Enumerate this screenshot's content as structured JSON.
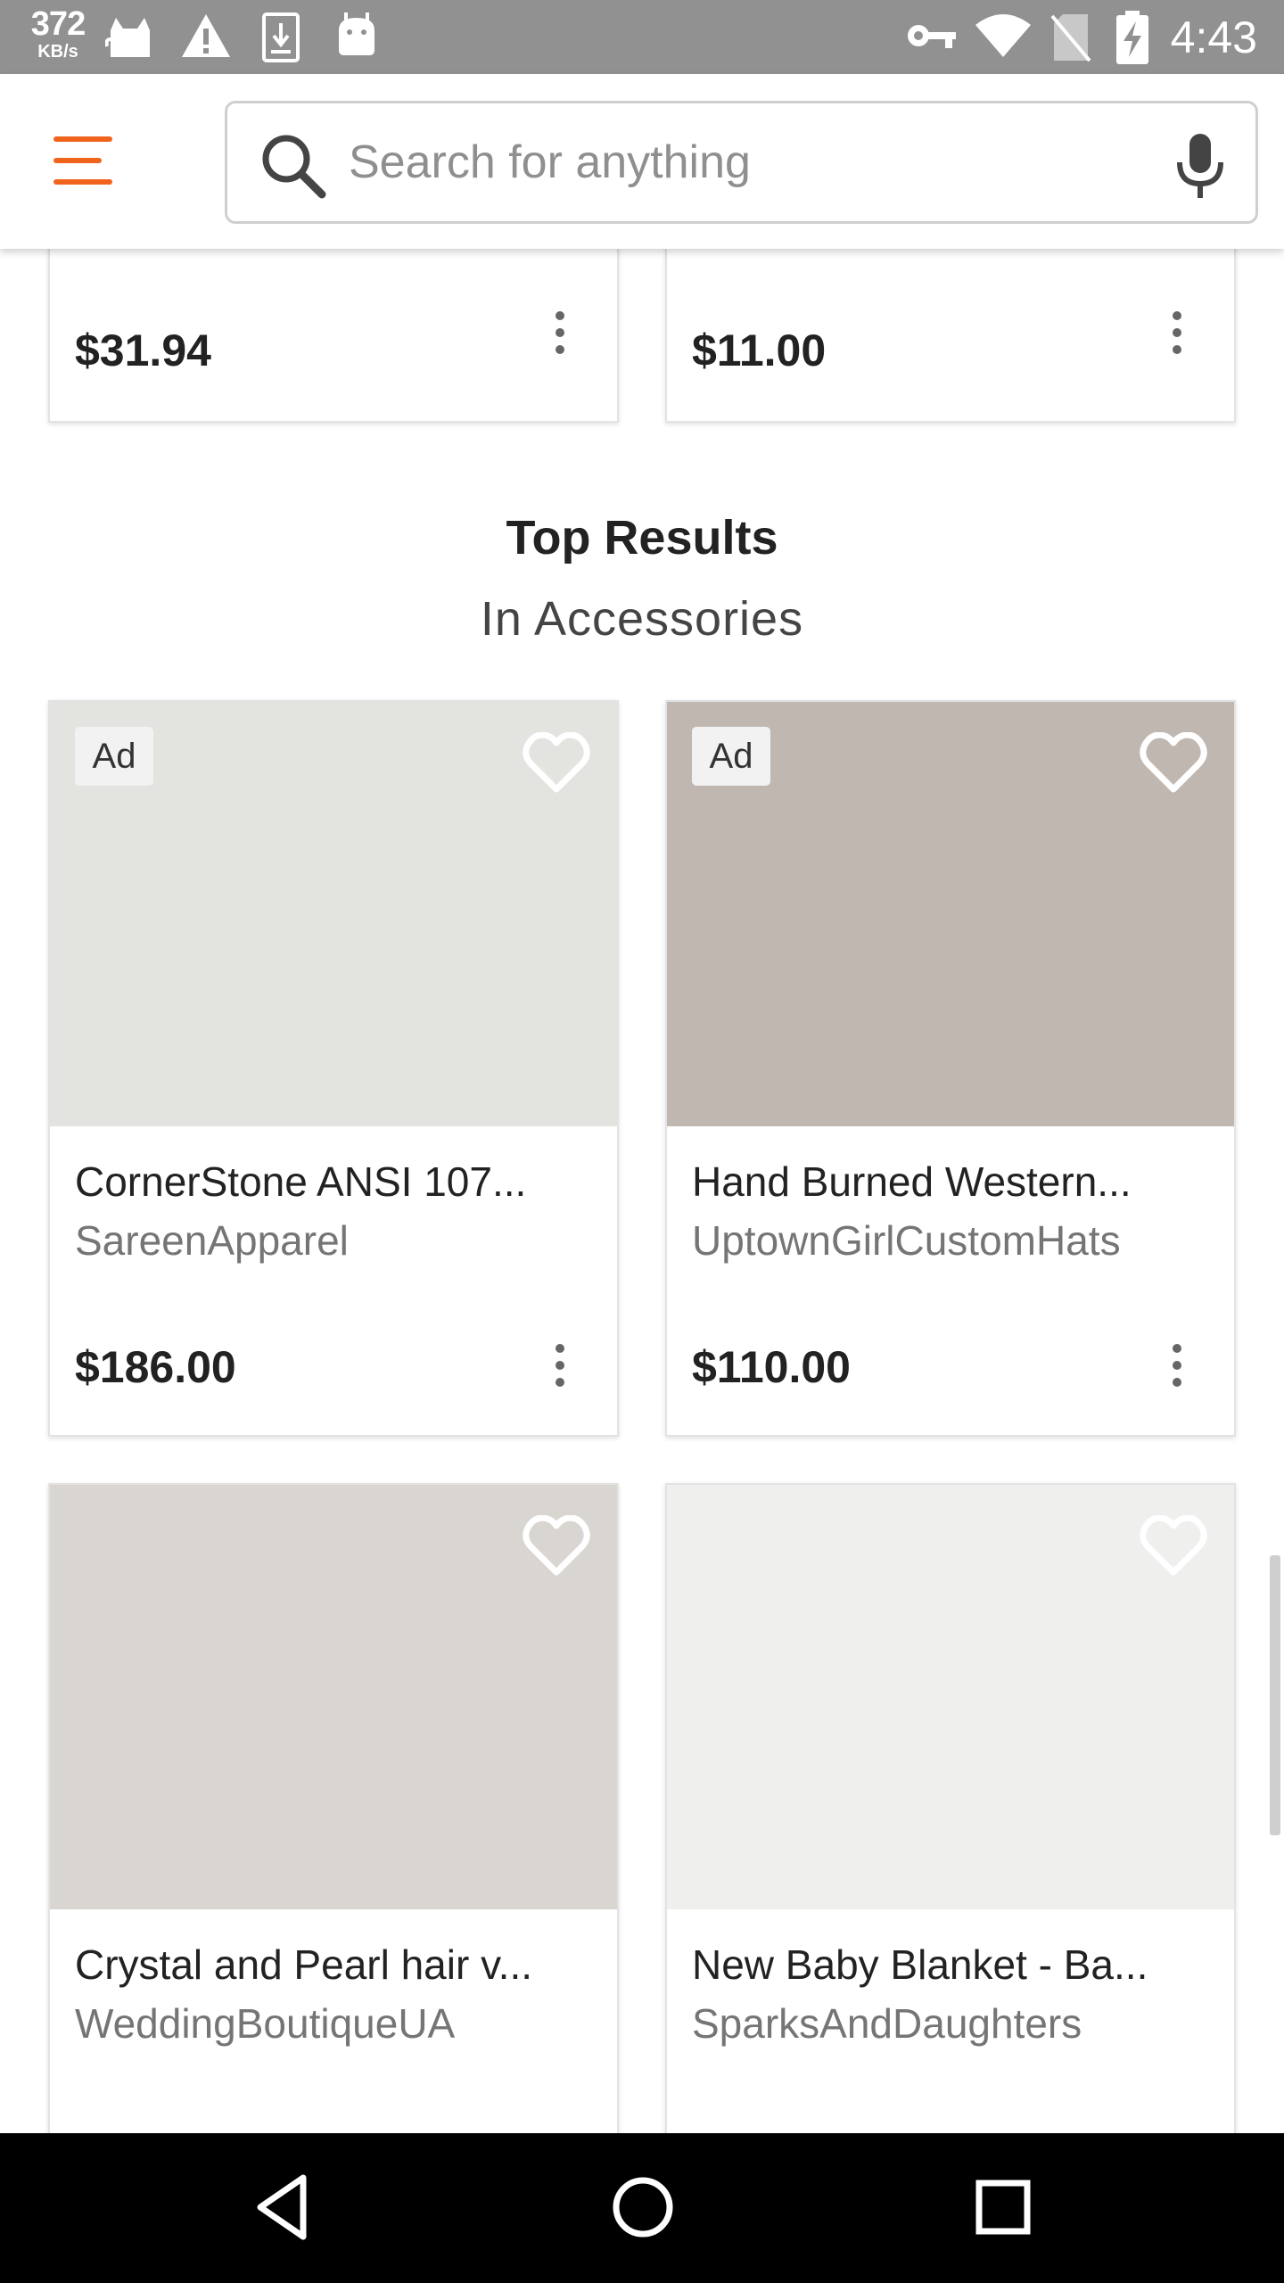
{
  "status_bar": {
    "speed_value": "372",
    "speed_unit": "KB/s",
    "time": "4:43",
    "icons": [
      "cat-icon",
      "warning-icon",
      "download-icon",
      "android-icon",
      "vpn-key-icon",
      "wifi-icon",
      "no-sim-icon",
      "battery-charging-icon"
    ]
  },
  "app_bar": {
    "menu_icon": "hamburger-menu-icon",
    "search": {
      "placeholder": "Search for anything",
      "value": ""
    },
    "mic_icon": "microphone-icon",
    "accent_color": "#f1641e"
  },
  "top_cards": [
    {
      "price": "$31.94"
    },
    {
      "price": "$11.00"
    }
  ],
  "section": {
    "title": "Top Results",
    "subtitle": "In Accessories"
  },
  "listings": [
    {
      "ad": "Ad",
      "title": "CornerStone ANSI 107...",
      "shop": "SareenApparel",
      "price": "$186.00",
      "image_color": "#e3e3e0"
    },
    {
      "ad": "Ad",
      "title": "Hand Burned Western...",
      "shop": "UptownGirlCustomHats",
      "price": "$110.00",
      "image_color": "#c0b7b1"
    },
    {
      "title": "Crystal and Pearl hair v...",
      "shop": "WeddingBoutiqueUA",
      "image_color": "#d9d5d0"
    },
    {
      "title": "New Baby Blanket - Ba...",
      "shop": "SparksAndDaughters",
      "image_color": "#efefee"
    }
  ],
  "nav_bar": {
    "back": "back-triangle-icon",
    "home": "home-circle-icon",
    "recents": "recents-square-icon"
  }
}
